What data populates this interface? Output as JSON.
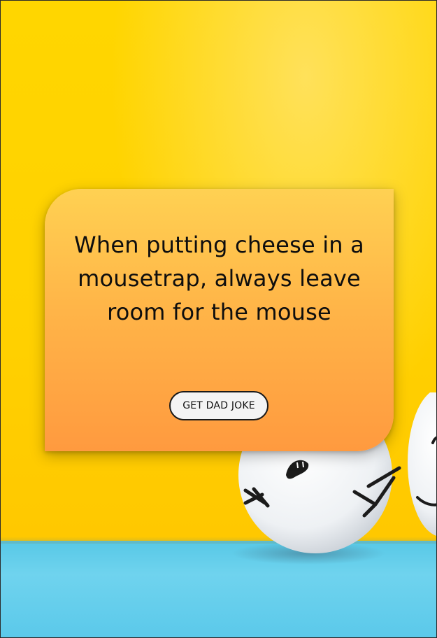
{
  "joke": {
    "text": "When putting cheese in a mousetrap, always leave room for the mouse"
  },
  "button": {
    "label": "GET DAD JOKE"
  },
  "colors": {
    "background": "#ffd600",
    "card_top": "#ffd152",
    "card_bottom": "#ff9a3f",
    "surface": "#5bc9ea",
    "button_bg": "#f4f4f4",
    "text": "#0e0e0e"
  },
  "icons": {
    "background_image": "ping-pong-egg-faces"
  }
}
